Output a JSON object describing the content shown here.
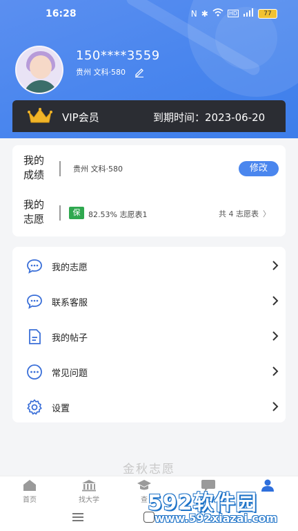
{
  "status_bar": {
    "time": "16:28",
    "battery": "77",
    "icons": [
      "nfc-icon",
      "bluetooth-icon",
      "wifi-icon",
      "hd-icon",
      "signal-icon",
      "battery-icon"
    ]
  },
  "profile": {
    "phone": "150****3559",
    "info": "贵州 文科·580"
  },
  "vip": {
    "label": "VIP会员",
    "expiry": "到期时间：2023-06-20"
  },
  "score": {
    "label": "我的成绩",
    "value": "贵州 文科·580",
    "modify_label": "修改"
  },
  "wish": {
    "label": "我的志愿",
    "badge": "保",
    "value": "82.53% 志愿表1",
    "total": "共 4 志愿表",
    "chevron": "〉"
  },
  "menu": [
    {
      "label": "我的志愿",
      "icon": "chat-bubble-icon"
    },
    {
      "label": "联系客服",
      "icon": "chat-bubble-icon"
    },
    {
      "label": "我的帖子",
      "icon": "document-icon"
    },
    {
      "label": "常见问题",
      "icon": "ellipsis-circle-icon"
    },
    {
      "label": "设置",
      "icon": "gear-icon"
    }
  ],
  "footer_title": "金秋志愿",
  "tabs": [
    {
      "label": "首页",
      "icon": "home-icon"
    },
    {
      "label": "找大学",
      "icon": "university-icon"
    },
    {
      "label": "查",
      "icon": "graduation-cap-icon"
    },
    {
      "label": "",
      "icon": "chat-icon"
    },
    {
      "label": "",
      "icon": "person-icon"
    }
  ],
  "watermark": {
    "brand": "592软件园",
    "url": "www.592xiazai.com"
  },
  "colors": {
    "primary": "#4a86ee",
    "vip_bg": "#2b2d33",
    "badge_green": "#2fa84f",
    "active_tab": "#2e6fdc"
  }
}
